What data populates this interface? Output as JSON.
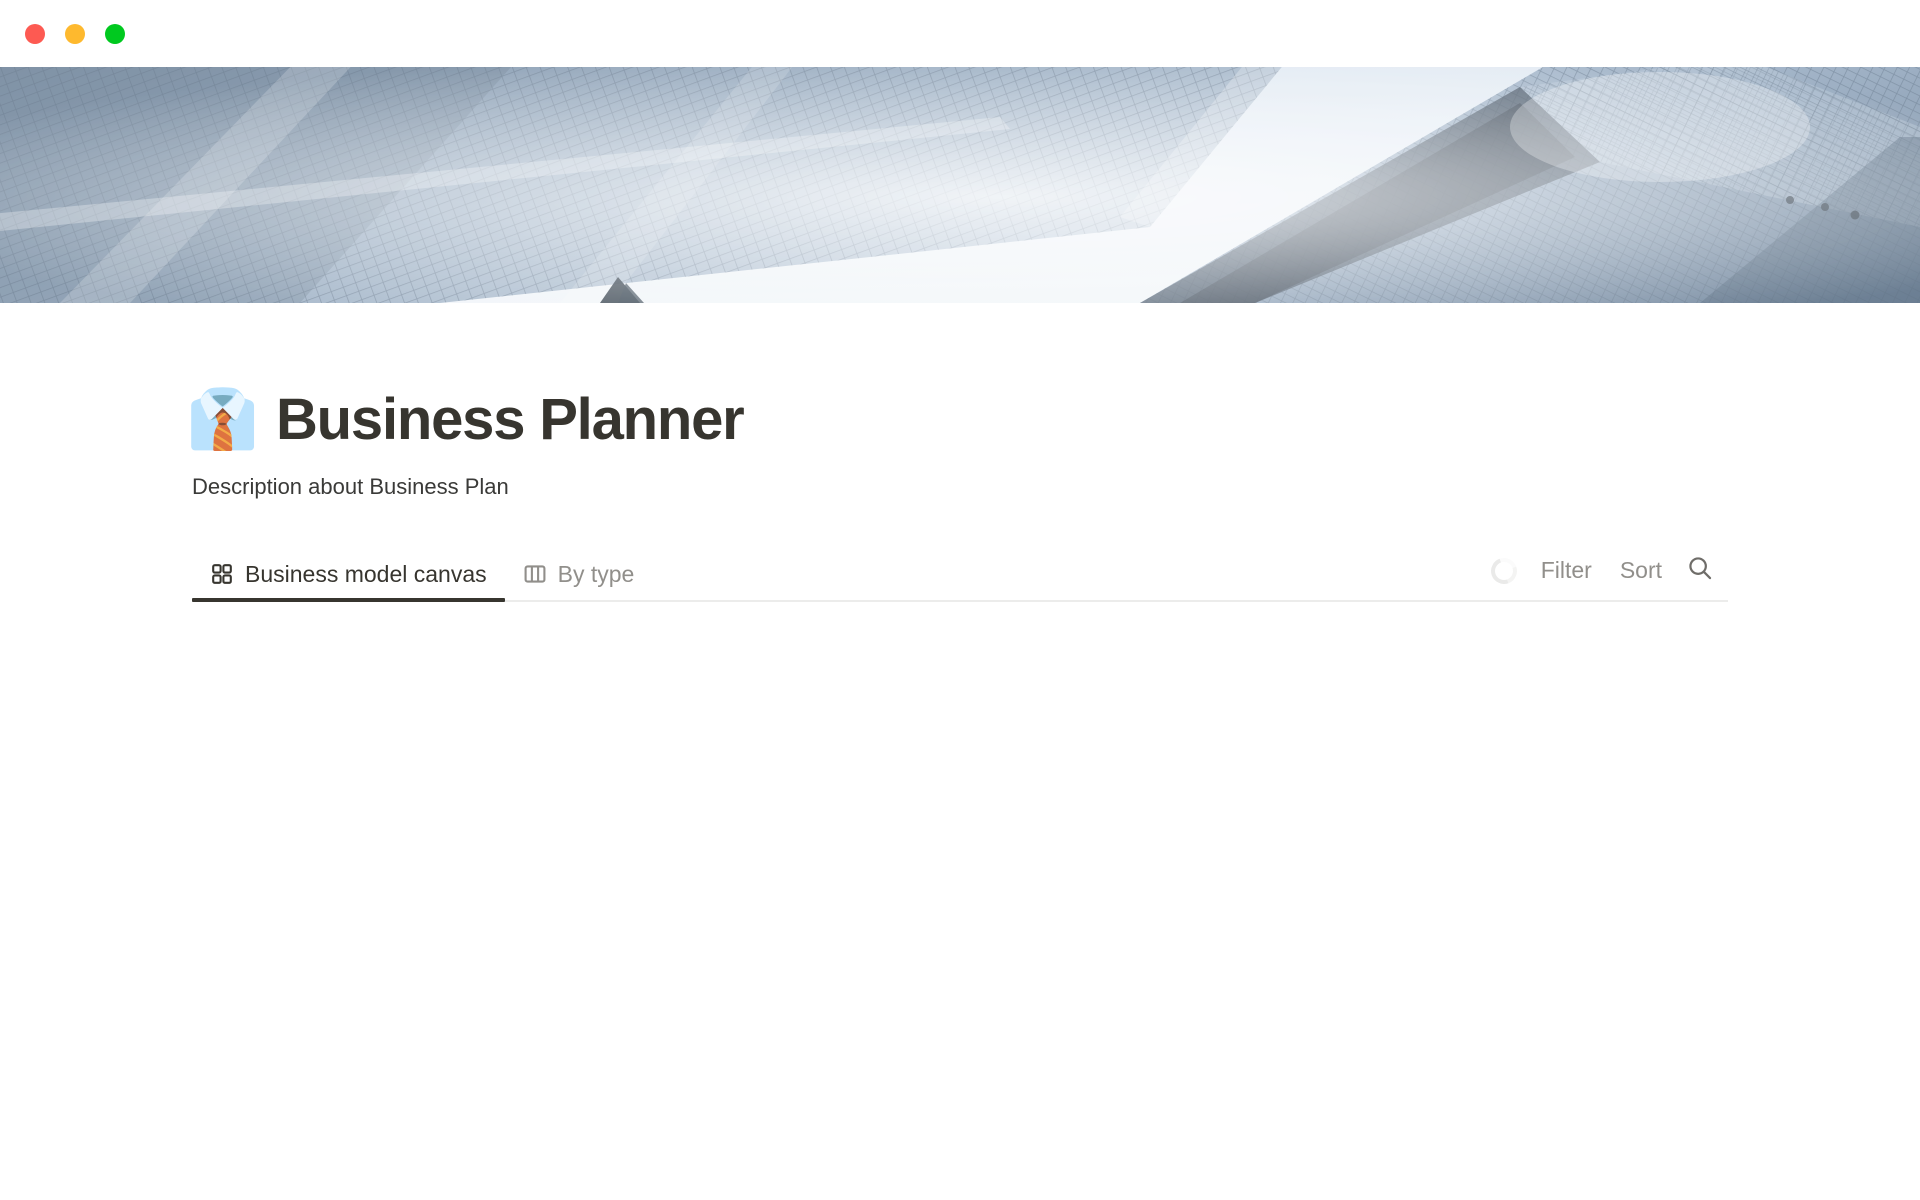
{
  "window": {
    "controls": [
      {
        "name": "close",
        "color": "#fd5a52"
      },
      {
        "name": "minimize",
        "color": "#feb92e"
      },
      {
        "name": "zoom",
        "color": "#00c91f"
      }
    ]
  },
  "cover": {
    "alt": "Low angle photo of two glass skyscrapers against a pale blue sky",
    "sky_color": "#e8eef5",
    "building_color": "#8fa4ba"
  },
  "page": {
    "emoji": "👔",
    "emoji_name": "necktie-emoji",
    "title": "Business Planner",
    "description": "Description about Business Plan",
    "title_color": "#37352f"
  },
  "collection": {
    "tabs": [
      {
        "label": "Business model canvas",
        "icon": "gallery-icon",
        "active": true
      },
      {
        "label": "By type",
        "icon": "board-icon",
        "active": false
      }
    ],
    "active_tab_index": 0,
    "active_underline_color": "#37352f",
    "toolbar": {
      "loading": true,
      "loading_icon": "spinner-icon",
      "filter_label": "Filter",
      "sort_label": "Sort",
      "search_icon": "search-icon",
      "muted_color": "#918f8b"
    },
    "rows": []
  }
}
